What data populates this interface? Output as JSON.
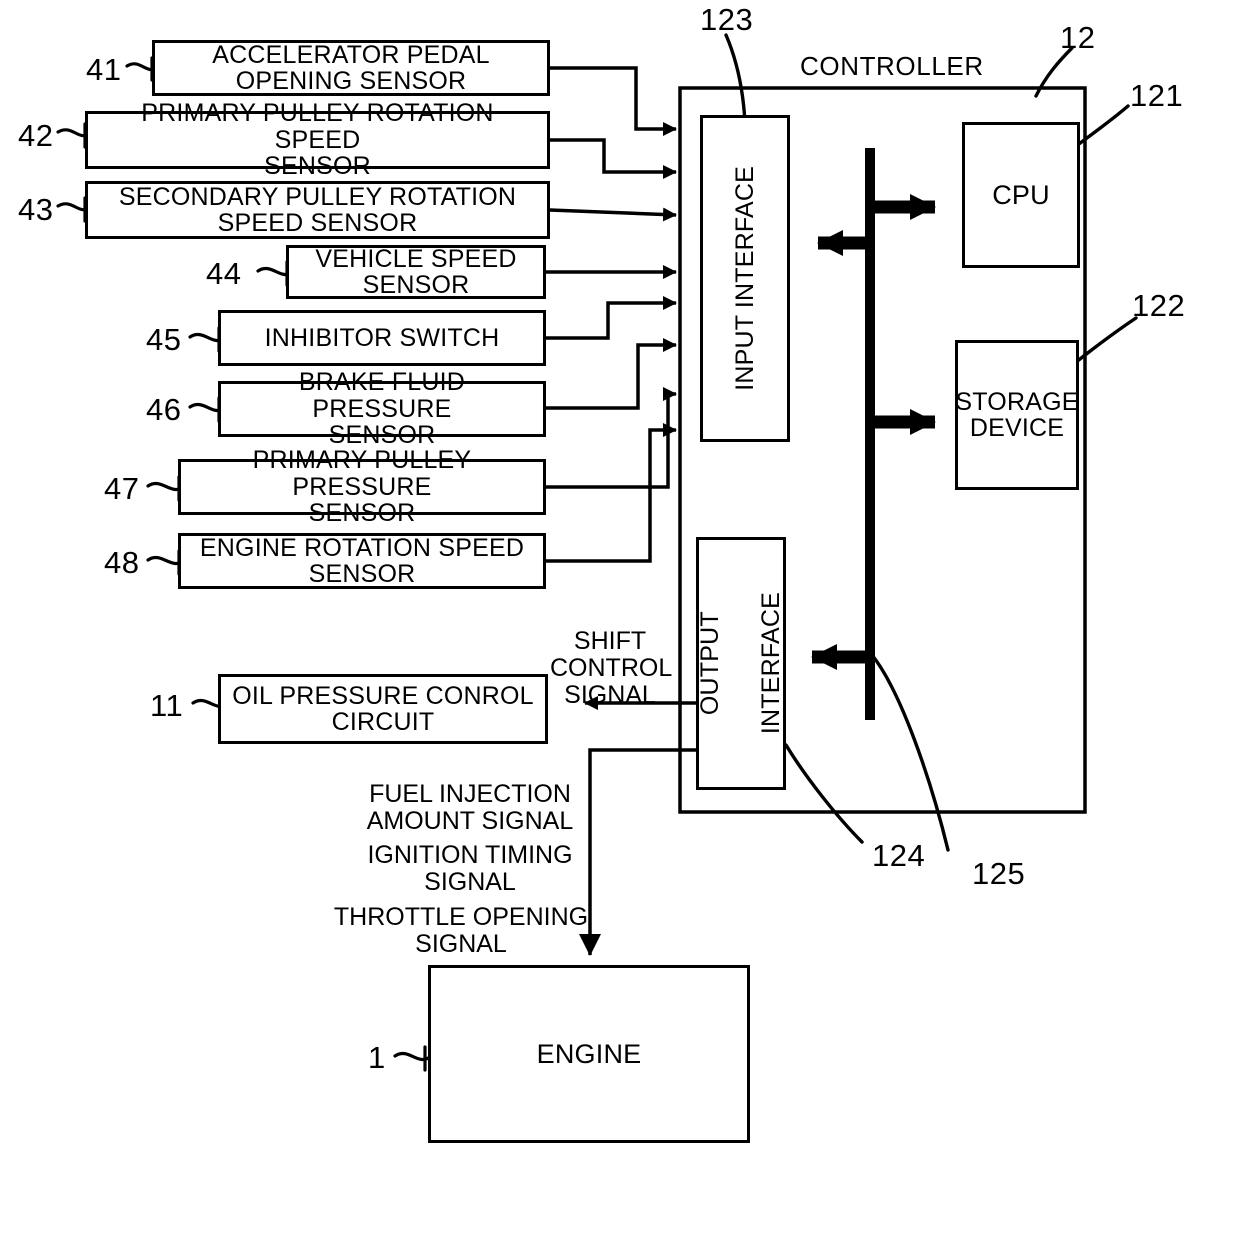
{
  "figure": {
    "title_text": "CONTROLLER",
    "line_color": "#000000",
    "background": "#ffffff"
  },
  "sensors": [
    {
      "ref": "41",
      "label_line1": "ACCELERATOR PEDAL",
      "label_line2": "OPENING SENSOR"
    },
    {
      "ref": "42",
      "label_line1": "PRIMARY PULLEY ROTATION SPEED",
      "label_line2": "SENSOR"
    },
    {
      "ref": "43",
      "label_line1": "SECONDARY PULLEY ROTATION",
      "label_line2": "SPEED SENSOR"
    },
    {
      "ref": "44",
      "label_line1": "VEHICLE SPEED",
      "label_line2": "SENSOR"
    },
    {
      "ref": "45",
      "label_line1": "INHIBITOR SWITCH",
      "label_line2": ""
    },
    {
      "ref": "46",
      "label_line1": "BRAKE FLUID PRESSURE",
      "label_line2": "SENSOR"
    },
    {
      "ref": "47",
      "label_line1": "PRIMARY PULLEY PRESSURE",
      "label_line2": "SENSOR"
    },
    {
      "ref": "48",
      "label_line1": "ENGINE ROTATION SPEED",
      "label_line2": "SENSOR"
    }
  ],
  "actuators": {
    "oil_circuit": {
      "ref": "11",
      "label_line1": "OIL PRESSURE CONROL",
      "label_line2": "CIRCUIT"
    },
    "engine": {
      "ref": "1",
      "label": "ENGINE"
    }
  },
  "controller": {
    "ref": "12",
    "title": "CONTROLLER",
    "input_interface": {
      "ref": "123",
      "label": "INPUT INTERFACE"
    },
    "output_interface": {
      "ref": "124",
      "label_line1": "OUTPUT",
      "label_line2": "INTERFACE"
    },
    "cpu": {
      "ref": "121",
      "label": "CPU"
    },
    "storage": {
      "ref": "122",
      "label_line1": "STORAGE",
      "label_line2": "DEVICE"
    },
    "bus": {
      "ref": "125"
    }
  },
  "signals": {
    "shift_control": "SHIFT\nCONTROL\nSIGNAL",
    "fuel_injection": "FUEL INJECTION\nAMOUNT SIGNAL",
    "ignition_timing": "IGNITION TIMING\nSIGNAL",
    "throttle_opening": "THROTTLE OPENING\nSIGNAL"
  }
}
